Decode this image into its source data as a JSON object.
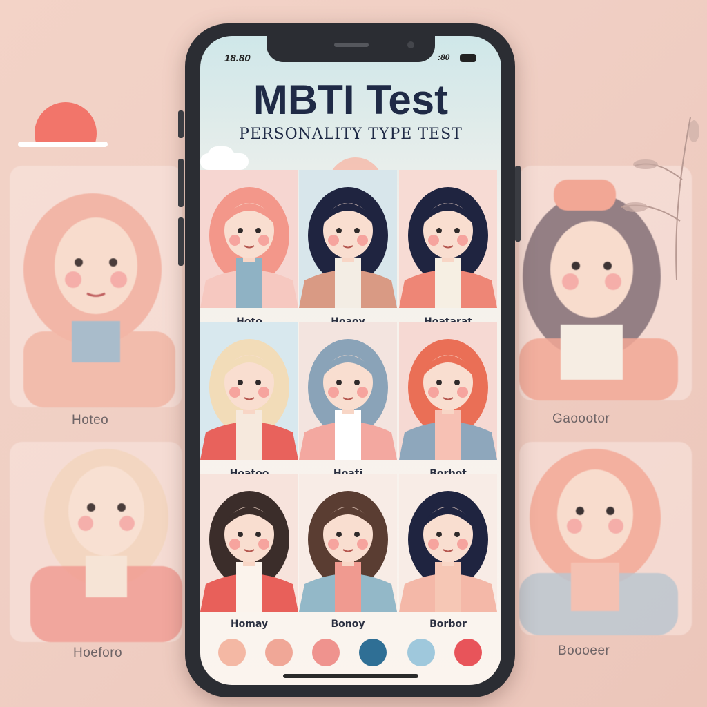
{
  "status_bar": {
    "time": "18.80",
    "right_text": ":80"
  },
  "header": {
    "title": "MBTI Test",
    "subtitle": "PERSONALITY TYPE TEST"
  },
  "grid": [
    {
      "label": "Hoto",
      "hair": "#f3978a",
      "top": "#8fb2c4",
      "jacket": "#f6c8c0",
      "bg": "#f6d6d1"
    },
    {
      "label": "Hoaoy",
      "hair": "#1f2440",
      "top": "#f3ede4",
      "jacket": "#d99a84",
      "bg": "#d8e6eb"
    },
    {
      "label": "Hoatarat",
      "hair": "#1f2440",
      "top": "#f6efe3",
      "jacket": "#ee8676",
      "bg": "#f7dbd4"
    },
    {
      "label": "Hoatoo",
      "hair": "#f2dcb8",
      "top": "#f6e9dd",
      "jacket": "#e8625c",
      "bg": "#d8e8ee"
    },
    {
      "label": "Hoati",
      "hair": "#8aa3b8",
      "top": "#ffffff",
      "jacket": "#f3a8a0",
      "bg": "#f3e4df"
    },
    {
      "label": "Borbot",
      "hair": "#ea6f56",
      "top": "#f7c1b4",
      "jacket": "#8ea7bc",
      "bg": "#f6d9d3"
    },
    {
      "label": "Homay",
      "hair": "#3b2d2a",
      "top": "#fbf3ec",
      "jacket": "#e8605a",
      "bg": "#f7e3dc"
    },
    {
      "label": "Bonoy",
      "hair": "#5a3d32",
      "top": "#f09a90",
      "jacket": "#93b8c8",
      "bg": "#f8ece6"
    },
    {
      "label": "Borbor",
      "hair": "#1f2440",
      "top": "#f6c7b5",
      "jacket": "#f4b8a8",
      "bg": "#f8ece6"
    }
  ],
  "swatches": [
    "#f4b8a4",
    "#f0a797",
    "#ef938e",
    "#2f6f95",
    "#9fc8dc",
    "#e8545a"
  ],
  "background_labels": {
    "left_top": "Hoteo",
    "left_bottom": "Hoeforo",
    "right_top": "Gaoootor",
    "right_bottom": "Boooeer"
  }
}
